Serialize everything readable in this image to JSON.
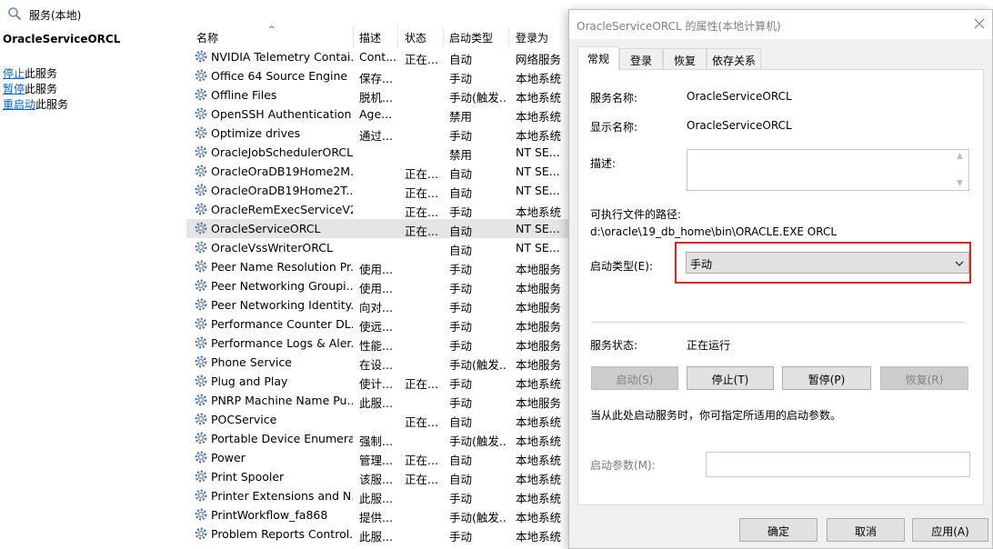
{
  "window": {
    "title": "服务(本地)"
  },
  "left_pane": {
    "service_name": "OracleServiceORCL",
    "actions": [
      {
        "link": "停止",
        "suffix": "此服务"
      },
      {
        "link": "暂停",
        "suffix": "此服务"
      },
      {
        "link": "重启动",
        "suffix": "此服务"
      }
    ]
  },
  "list": {
    "columns": [
      "名称",
      "描述",
      "状态",
      "启动类型",
      "登录为"
    ],
    "rows": [
      {
        "name": "NVIDIA Telemetry Contai...",
        "desc": "Cont...",
        "status": "正在...",
        "startup": "自动",
        "logon": "网络服务"
      },
      {
        "name": "Office 64 Source Engine",
        "desc": "保存...",
        "status": "",
        "startup": "手动",
        "logon": "本地系统"
      },
      {
        "name": "Offline Files",
        "desc": "脱机...",
        "status": "",
        "startup": "手动(触发...",
        "logon": "本地系统"
      },
      {
        "name": "OpenSSH Authentication ...",
        "desc": "Age...",
        "status": "",
        "startup": "禁用",
        "logon": "本地系统"
      },
      {
        "name": "Optimize drives",
        "desc": "通过...",
        "status": "",
        "startup": "手动",
        "logon": "本地系统"
      },
      {
        "name": "OracleJobSchedulerORCL",
        "desc": "",
        "status": "",
        "startup": "禁用",
        "logon": "NT SE..."
      },
      {
        "name": "OracleOraDB19Home2M...",
        "desc": "",
        "status": "正在...",
        "startup": "自动",
        "logon": "NT SE..."
      },
      {
        "name": "OracleOraDB19Home2T...",
        "desc": "",
        "status": "正在...",
        "startup": "自动",
        "logon": "NT SE..."
      },
      {
        "name": "OracleRemExecServiceV2",
        "desc": "",
        "status": "正在...",
        "startup": "手动",
        "logon": "本地系统"
      },
      {
        "name": "OracleServiceORCL",
        "desc": "",
        "status": "正在...",
        "startup": "自动",
        "logon": "NT SE...",
        "selected": true
      },
      {
        "name": "OracleVssWriterORCL",
        "desc": "",
        "status": "",
        "startup": "自动",
        "logon": "NT SE..."
      },
      {
        "name": "Peer Name Resolution Pr...",
        "desc": "使用...",
        "status": "",
        "startup": "手动",
        "logon": "本地服务"
      },
      {
        "name": "Peer Networking Groupi...",
        "desc": "使用...",
        "status": "",
        "startup": "手动",
        "logon": "本地服务"
      },
      {
        "name": "Peer Networking Identity...",
        "desc": "向对...",
        "status": "",
        "startup": "手动",
        "logon": "本地服务"
      },
      {
        "name": "Performance Counter DL...",
        "desc": "使远...",
        "status": "",
        "startup": "手动",
        "logon": "本地服务"
      },
      {
        "name": "Performance Logs & Aler...",
        "desc": "性能...",
        "status": "",
        "startup": "手动",
        "logon": "本地服务"
      },
      {
        "name": "Phone Service",
        "desc": "在设...",
        "status": "",
        "startup": "手动(触发...",
        "logon": "本地服务"
      },
      {
        "name": "Plug and Play",
        "desc": "使计...",
        "status": "正在...",
        "startup": "手动",
        "logon": "本地系统"
      },
      {
        "name": "PNRP Machine Name Pu...",
        "desc": "此服...",
        "status": "",
        "startup": "手动",
        "logon": "本地服务"
      },
      {
        "name": "POCService",
        "desc": "",
        "status": "正在...",
        "startup": "自动",
        "logon": "本地系统"
      },
      {
        "name": "Portable Device Enumera...",
        "desc": "强制...",
        "status": "",
        "startup": "手动(触发...",
        "logon": "本地系统"
      },
      {
        "name": "Power",
        "desc": "管理...",
        "status": "正在...",
        "startup": "自动",
        "logon": "本地系统"
      },
      {
        "name": "Print Spooler",
        "desc": "该服...",
        "status": "正在...",
        "startup": "自动",
        "logon": "本地系统"
      },
      {
        "name": "Printer Extensions and N...",
        "desc": "此服...",
        "status": "",
        "startup": "手动",
        "logon": "本地系统"
      },
      {
        "name": "PrintWorkflow_fa868",
        "desc": "提供...",
        "status": "",
        "startup": "手动(触发...",
        "logon": "本地系统"
      },
      {
        "name": "Problem Reports Control...",
        "desc": "此服...",
        "status": "",
        "startup": "手动",
        "logon": "本地系统"
      }
    ]
  },
  "dialog": {
    "title": "OracleServiceORCL 的属性(本地计算机)",
    "tabs": [
      "常规",
      "登录",
      "恢复",
      "依存关系"
    ],
    "service_name_label": "服务名称:",
    "service_name": "OracleServiceORCL",
    "display_name_label": "显示名称:",
    "display_name": "OracleServiceORCL",
    "description_label": "描述:",
    "exe_path_label": "可执行文件的路径:",
    "exe_path": "d:\\oracle\\19_db_home\\bin\\ORACLE.EXE ORCL",
    "startup_type_label": "启动类型(E):",
    "startup_type": "手动",
    "status_label": "服务状态:",
    "status": "正在运行",
    "buttons": {
      "start": "启动(S)",
      "stop": "停止(T)",
      "pause": "暂停(P)",
      "resume": "恢复(R)"
    },
    "hint": "当从此处启动服务时，你可指定所适用的启动参数。",
    "param_label": "启动参数(M):",
    "ok": "确定",
    "cancel": "取消",
    "apply": "应用(A)"
  }
}
